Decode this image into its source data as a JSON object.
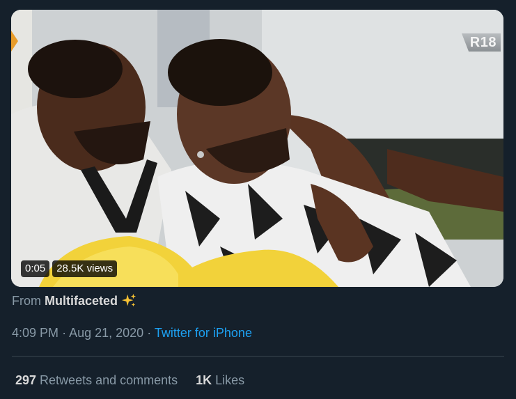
{
  "video": {
    "rating": "R18",
    "duration": "0:05",
    "views": "28.5K views"
  },
  "attribution": {
    "prefix": "From",
    "name": "Multifaceted",
    "emoji_icon": "sparkles-icon"
  },
  "meta": {
    "time": "4:09 PM",
    "separator": "·",
    "date": "Aug 21, 2020",
    "source": "Twitter for iPhone"
  },
  "stats": {
    "retweets_count": "297",
    "retweets_label": "Retweets and comments",
    "likes_count": "1K",
    "likes_label": "Likes"
  },
  "colors": {
    "background": "#15202b",
    "link": "#1da1f2",
    "muted": "#8899a6",
    "divider": "#38444d"
  }
}
